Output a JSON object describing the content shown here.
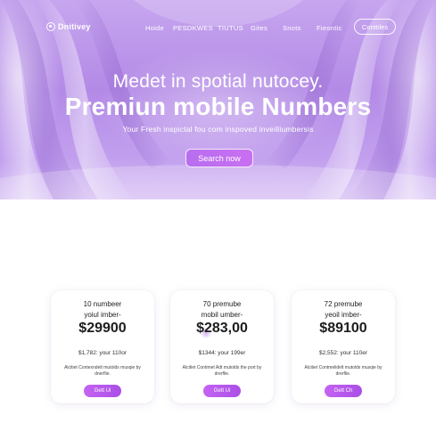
{
  "nav": {
    "brand": "Dnitivey",
    "links": [
      "Hoide",
      "PESDKWES",
      "TIUTUS",
      "Gites",
      "Snots",
      "Fieontic"
    ],
    "cta": "Conttiles"
  },
  "hero": {
    "eyebrow": "Medet in spotial nutocey.",
    "headline": "Premiun mobile Numbers",
    "subline": "Your Fresh inspictal fou com inspoved inveilliumbersis",
    "search_button": "Search now"
  },
  "plans": [
    {
      "title_line1": "10 numbeer",
      "title_line2": "yoiul imber-",
      "price": "$29900",
      "monthly": "$1,782: your 110or",
      "description": "Alcitiet Contexndelt mutolds musqie by dnerflie.",
      "button": "Gett Ui"
    },
    {
      "title_line1": "70 premube",
      "title_line2": "mobil umber-",
      "price": "$283,00",
      "monthly": "$1344: your 199er",
      "description": "Alcitiet Contimet Adt mutolds the port by drerflie.",
      "button": "Gett Ui"
    },
    {
      "title_line1": "72 premube",
      "title_line2": "yeoil imber-",
      "price": "$89100",
      "monthly": "$2,552: your 110er",
      "description": "Alcitiet Contmelidelt mutolds musqie by drerflie.",
      "button": "Gett Ch"
    }
  ],
  "colors": {
    "hero_purple": "#b38ae6",
    "button_purple": "#c563f2",
    "text_dark": "#1d1d1d"
  }
}
